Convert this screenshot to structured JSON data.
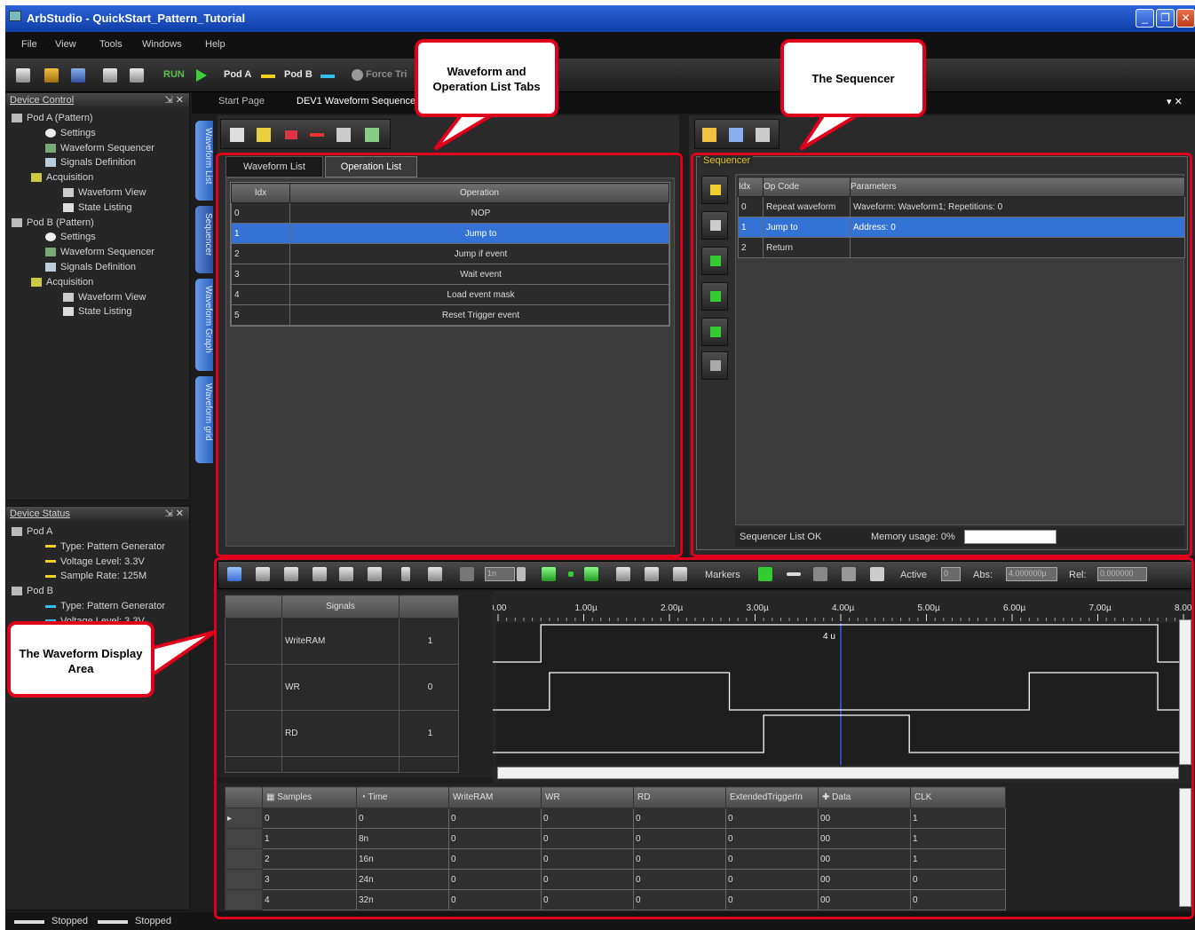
{
  "window": {
    "title": "ArbStudio - QuickStart_Pattern_Tutorial",
    "buttons": [
      "_",
      "❐",
      "✕"
    ]
  },
  "menu": [
    "File",
    "View",
    "Tools",
    "Windows",
    "Help"
  ],
  "toolbar": {
    "run_label": "RUN",
    "pod_a_label": "Pod A",
    "pod_b_label": "Pod B",
    "force_label": "Force Tri"
  },
  "device_control": {
    "title": "Device Control",
    "items": [
      "Pod A (Pattern)",
      "Settings",
      "Waveform Sequencer",
      "Signals Definition",
      "Acquisition",
      "Waveform View",
      "State Listing",
      "Pod B (Pattern)",
      "Settings",
      "Waveform Sequencer",
      "Signals Definition",
      "Acquisition",
      "Waveform View",
      "State Listing"
    ]
  },
  "device_status": {
    "title": "Device Status",
    "items": [
      "Pod A",
      "Type: Pattern Generator",
      "Voltage Level: 3.3V",
      "Sample Rate: 125M",
      "Pod B",
      "Type: Pattern Generator",
      "Voltage Level: 3.3V"
    ]
  },
  "side_tabs": [
    "Waveform List",
    "Sequencer",
    "Waveform Graph",
    "Waveform grid"
  ],
  "doc_tabs": [
    "Start Page",
    "DEV1 Waveform Sequence"
  ],
  "list_tabs": [
    "Waveform List",
    "Operation List"
  ],
  "operation_list": {
    "headers": [
      "Idx",
      "Operation"
    ],
    "rows": [
      [
        "0",
        "NOP"
      ],
      [
        "1",
        "Jump to"
      ],
      [
        "2",
        "Jump if event"
      ],
      [
        "3",
        "Wait event"
      ],
      [
        "4",
        "Load event mask"
      ],
      [
        "5",
        "Reset Trigger event"
      ]
    ],
    "selected": 1
  },
  "sequencer": {
    "title": "Sequencer",
    "headers": [
      "Idx",
      "Op Code",
      "Parameters"
    ],
    "rows": [
      [
        "0",
        "Repeat waveform",
        "Waveform: Waveform1; Repetitions: 0"
      ],
      [
        "1",
        "Jump to",
        "Address: 0"
      ],
      [
        "2",
        "Return",
        ""
      ]
    ],
    "selected": 1,
    "status": "Sequencer List OK",
    "memory_label": "Memory usage: 0%",
    "memory_fraction": 0.0
  },
  "waveform_toolbar": {
    "spin_value": "1n",
    "markers_label": "Markers",
    "active_label": "Active",
    "active_value": "0",
    "abs_label": "Abs:",
    "abs_value": "4.000000µ",
    "rel_label": "Rel:",
    "rel_value": "0.000000"
  },
  "signals": {
    "header": "Signals",
    "rows": [
      {
        "name": "WriteRAM",
        "value": "1"
      },
      {
        "name": "WR",
        "value": "0"
      },
      {
        "name": "RD",
        "value": "1"
      }
    ]
  },
  "time_axis": {
    "ticks": [
      "0.00",
      "1.00µ",
      "2.00µ",
      "3.00µ",
      "4.00µ",
      "5.00µ",
      "6.00µ",
      "7.00µ",
      "8.00µ"
    ],
    "cursor_label": "4 u"
  },
  "waveforms": [
    {
      "name": "WriteRAM",
      "edges_us": [
        0.5,
        7.7
      ],
      "start_level": 0
    },
    {
      "name": "WR",
      "edges_us": [
        0.6,
        2.7,
        6.2,
        7.7
      ],
      "start_level": 0
    },
    {
      "name": "RD",
      "edges_us": [
        3.1,
        4.8
      ],
      "start_level": 0
    }
  ],
  "samples": {
    "headers": [
      "Samples",
      "Time",
      "WriteRAM",
      "WR",
      "RD",
      "ExtendedTriggerIn",
      "Data",
      "CLK"
    ],
    "rows": [
      [
        "0",
        "0",
        "0",
        "0",
        "0",
        "0",
        "00",
        "1"
      ],
      [
        "1",
        "8n",
        "0",
        "0",
        "0",
        "0",
        "00",
        "1"
      ],
      [
        "2",
        "16n",
        "0",
        "0",
        "0",
        "0",
        "00",
        "1"
      ],
      [
        "3",
        "24n",
        "0",
        "0",
        "0",
        "0",
        "00",
        "0"
      ],
      [
        "4",
        "32n",
        "0",
        "0",
        "0",
        "0",
        "00",
        "0"
      ]
    ]
  },
  "status_bar": [
    "Stopped",
    "Stopped"
  ],
  "callouts": {
    "tabs": "Waveform and Operation List Tabs",
    "sequencer": "The Sequencer",
    "display": "The Waveform Display Area"
  }
}
